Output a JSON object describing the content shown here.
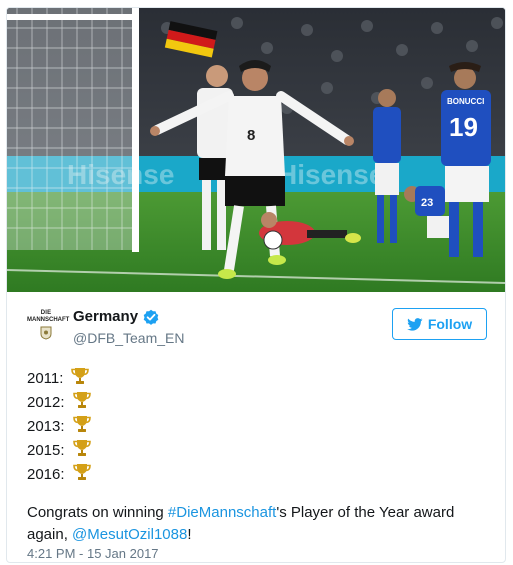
{
  "photo": {
    "alt": "",
    "player_number": "8",
    "opponent_name": "BONUCCI",
    "opponent_number": "19",
    "keeper_number": "23"
  },
  "author": {
    "avatar_text_top": "DIE",
    "avatar_text_bottom": "MANNSCHAFT",
    "display_name": "Germany",
    "handle": "@DFB_Team_EN",
    "verified_icon": "verified-badge-icon"
  },
  "follow_button": {
    "label": "Follow",
    "icon": "twitter-bird-icon"
  },
  "tweet": {
    "years": [
      {
        "year": "2011:",
        "icon": "trophy-icon"
      },
      {
        "year": "2012:",
        "icon": "trophy-icon"
      },
      {
        "year": "2013:",
        "icon": "trophy-icon"
      },
      {
        "year": "2015:",
        "icon": "trophy-icon"
      },
      {
        "year": "2016:",
        "icon": "trophy-icon"
      }
    ],
    "congrats_prefix": "Congrats on winning ",
    "hashtag": "#DieMannschaft",
    "congrats_middle": "'s Player of the Year award again, ",
    "mention": "@MesutOzil1088",
    "congrats_suffix": "!"
  },
  "timestamp": "4:21 PM - 15 Jan 2017",
  "colors": {
    "link": "#1b95e0",
    "follow": "#1da1f2",
    "muted": "#657786",
    "border": "#e1e8ed",
    "trophy": "#d4a017",
    "pitch": "#3f8f2c",
    "italy_blue": "#1f4fbf"
  }
}
